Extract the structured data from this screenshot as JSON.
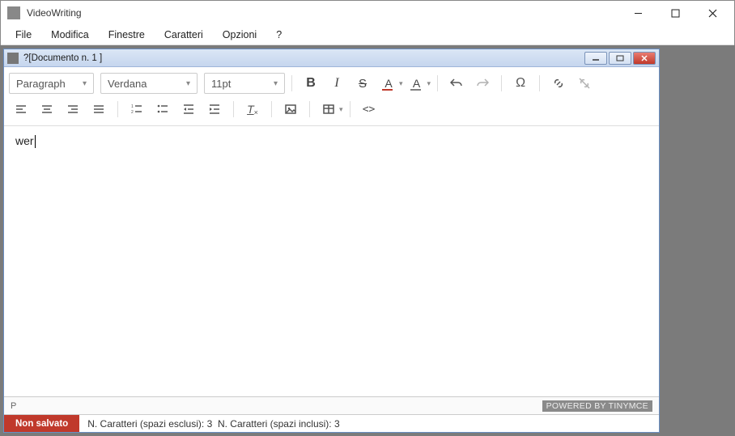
{
  "app": {
    "title": "VideoWriting"
  },
  "menu": {
    "items": [
      "File",
      "Modifica",
      "Finestre",
      "Caratteri",
      "Opzioni",
      "?"
    ]
  },
  "document": {
    "title": "?[Documento n. 1 ]"
  },
  "toolbar": {
    "paragraph": "Paragraph",
    "font": "Verdana",
    "size": "11pt",
    "textColor": "#c0392b",
    "bgColor": "#808080"
  },
  "editor": {
    "content": "wer",
    "path": "P",
    "powered": "POWERED BY TINYMCE"
  },
  "status": {
    "saveBadge": "Non salvato",
    "charExclLabel": "N. Caratteri (spazi esclusi):",
    "charExclValue": "3",
    "charInclLabel": "N. Caratteri (spazi inclusi):",
    "charInclValue": "3"
  }
}
